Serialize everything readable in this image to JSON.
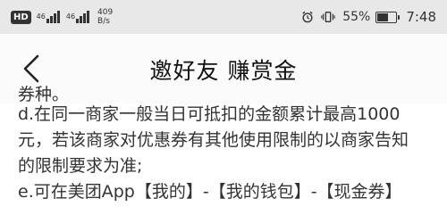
{
  "status_bar": {
    "hd_badge": "HD",
    "signal_1_tag": "46",
    "signal_2_tag": "46",
    "net_speed_value": "409",
    "net_speed_unit": "B/s",
    "battery_percent": "55%",
    "time": "7:48"
  },
  "nav": {
    "title": "邀好友 赚赏金"
  },
  "content": {
    "cut_line": "券种。",
    "line_d1": "d.在同一商家一般当日可抵扣的金额累计最高1000",
    "line_d2": "元，若该商家对优惠券有其他使用限制的以商家告知",
    "line_d3": "的限制要求为准;",
    "line_e1": "e.可在美团App【我的】-【我的钱包】-【现金券】"
  }
}
